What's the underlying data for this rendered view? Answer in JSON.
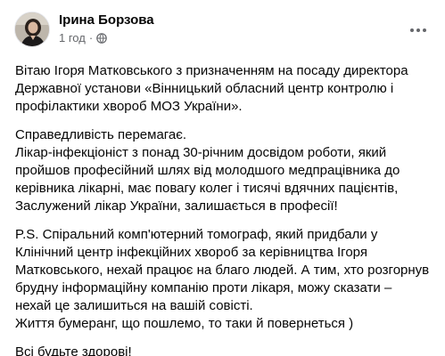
{
  "post": {
    "author": "Ірина Борзова",
    "time": "1 год",
    "separator": "·",
    "privacy_icon": "globe-icon",
    "more_icon": "more-options-icon",
    "paragraphs": [
      {
        "lines": [
          "Вітаю Ігоря Матковського з призначенням на посаду директора",
          "Державної установи «Вінницький обласний центр контролю і",
          "профілактики хвороб МОЗ України»."
        ]
      },
      {
        "lines": [
          "Справедливість перемагає.",
          "Лікар-інфекціоніст з понад 30-річним досвідом роботи, який",
          "пройшов професійний шлях від молодшого медпрацівника до",
          "керівника лікарні, має повагу колег і тисячі вдячних пацієнтів,",
          "Заслужений лікар України, залишається в професії!"
        ]
      },
      {
        "lines": [
          "P.S. Спіральний комп'ютерний томограф, який придбали у",
          "Клінічний центр інфекційних хвороб за керівництва Ігоря",
          "Матковського, нехай працює на благо людей. А тим, хто розгорнув",
          "брудну інформаційну компанію проти лікаря, можу сказати –",
          "нехай це залишиться на вашій совісті.",
          "Життя бумеранг, що пошлемо, то таки й повернеться )"
        ]
      },
      {
        "lines": [
          "Всі будьте здорові!"
        ]
      }
    ]
  }
}
